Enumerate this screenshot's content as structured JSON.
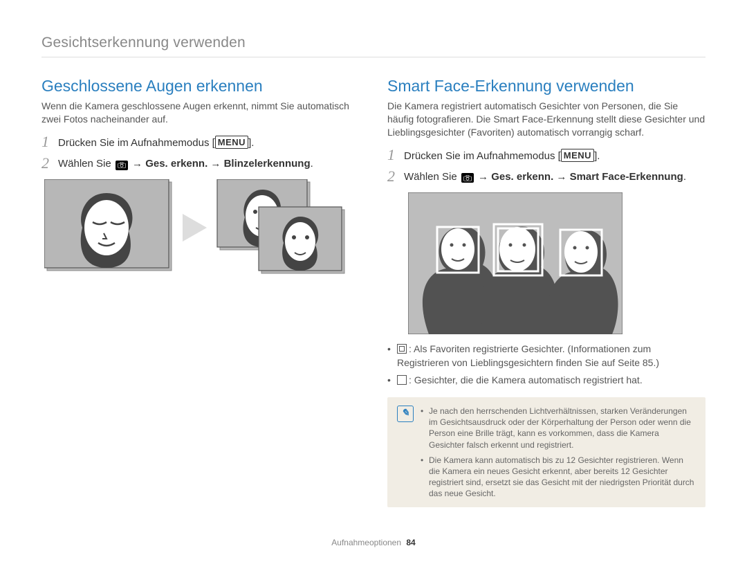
{
  "header": "Gesichtserkennung verwenden",
  "left": {
    "title": "Geschlossene Augen erkennen",
    "intro": "Wenn die Kamera geschlossene Augen erkennt, nimmt Sie automatisch zwei Fotos nacheinander auf.",
    "step1_a": "Drücken Sie im Aufnahmemodus [",
    "step1_menu": "MENU",
    "step1_b": "].",
    "step2_a": "Wählen Sie ",
    "step2_b": " → Ges. erkenn. → Blinzelerkennung",
    "step2_c": "."
  },
  "right": {
    "title": "Smart Face-Erkennung verwenden",
    "intro": "Die Kamera registriert automatisch Gesichter von Personen, die Sie häufig fotografieren. Die Smart Face-Erkennung stellt diese Gesichter und Lieblingsgesichter (Favoriten) automatisch vorrangig scharf.",
    "step1_a": "Drücken Sie im Aufnahmemodus [",
    "step1_menu": "MENU",
    "step1_b": "].",
    "step2_a": "Wählen Sie ",
    "step2_b": " → Ges. erkenn. → Smart Face-Erkennung",
    "step2_c": ".",
    "bullet1": ": Als Favoriten registrierte Gesichter. (Informationen zum Registrieren von Lieblingsgesichtern finden Sie auf Seite 85.)",
    "bullet2": ": Gesichter, die die Kamera automatisch registriert hat.",
    "note1": "Je nach den herrschenden Lichtverhältnissen, starken Veränderungen im Gesichtsausdruck oder der Körperhaltung der Person oder wenn die Person eine Brille trägt, kann es vorkommen, dass die Kamera Gesichter falsch erkennt und registriert.",
    "note2": "Die Kamera kann automatisch bis zu 12 Gesichter registrieren. Wenn die Kamera ein neues Gesicht erkennt, aber bereits 12 Gesichter registriert sind, ersetzt sie das Gesicht mit der niedrigsten Priorität durch das neue Gesicht."
  },
  "step_num_1": "1",
  "step_num_2": "2",
  "footer_label": "Aufnahmeoptionen",
  "footer_page": "84"
}
